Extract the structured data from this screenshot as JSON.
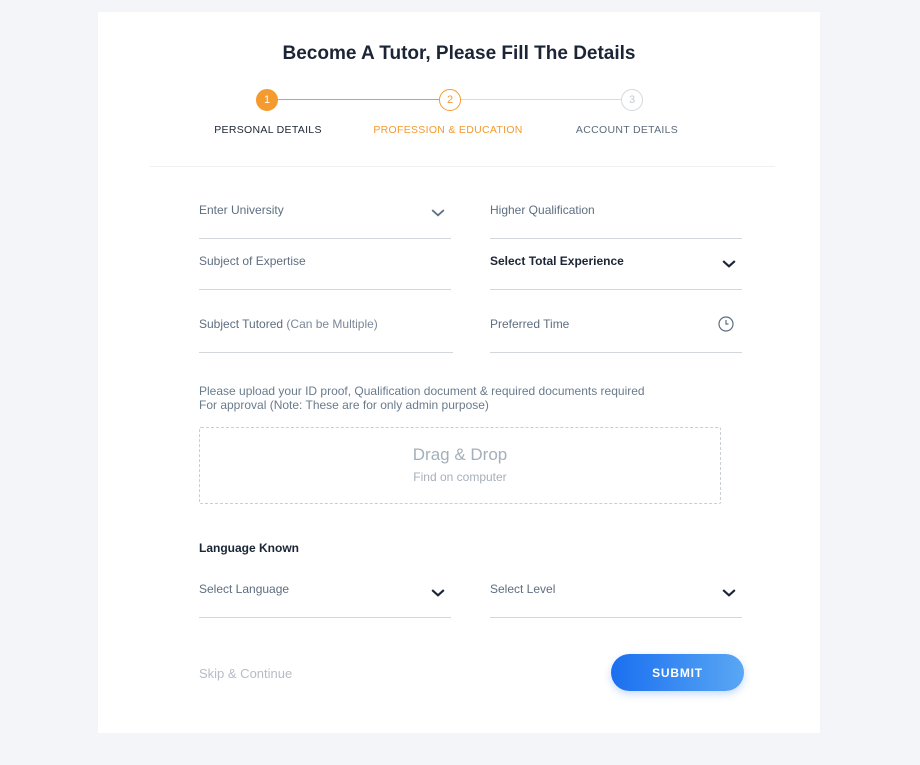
{
  "title": "Become A Tutor, Please Fill The Details",
  "stepper": {
    "steps": [
      {
        "number": "1",
        "label": "PERSONAL DETAILS",
        "state": "completed"
      },
      {
        "number": "2",
        "label": "PROFESSION & EDUCATION",
        "state": "active"
      },
      {
        "number": "3",
        "label": "ACCOUNT DETAILS",
        "state": "pending"
      }
    ]
  },
  "fields": {
    "university": {
      "label": "Enter University",
      "icon": "chevron-down-icon"
    },
    "qualification": {
      "label": "Higher Qualification"
    },
    "expertise": {
      "label": "Subject of Expertise"
    },
    "experience": {
      "label": "Select Total Experience",
      "icon": "chevron-down-icon"
    },
    "tutored": {
      "label": "Subject Tutored",
      "hint": "(Can be Multiple)"
    },
    "preferred_time": {
      "label": "Preferred Time",
      "icon": "clock-icon"
    }
  },
  "upload": {
    "note_line1": "Please upload your ID proof, Qualification document & required documents required",
    "note_line2": "For approval (Note: These are for only admin purpose)",
    "title": "Drag & Drop",
    "subtitle": "Find on computer"
  },
  "languages": {
    "heading": "Language Known",
    "language_label": "Select Language",
    "level_label": "Select Level"
  },
  "actions": {
    "skip_label": "Skip & Continue",
    "submit_label": "SUBMIT"
  },
  "colors": {
    "accent_orange": "#f59a2e",
    "primary_blue": "#1a6ff0",
    "background": "#f4f5f8"
  }
}
